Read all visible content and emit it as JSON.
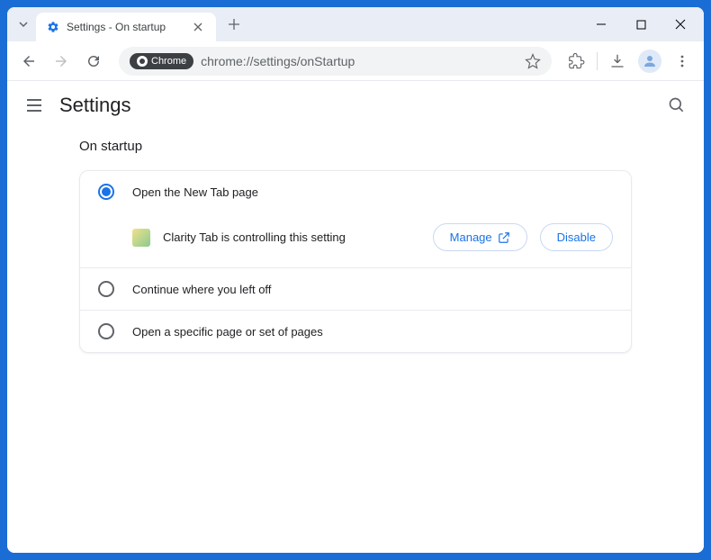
{
  "titlebar": {
    "tab_title": "Settings - On startup"
  },
  "toolbar": {
    "chrome_chip": "Chrome",
    "url": "chrome://settings/onStartup"
  },
  "header": {
    "title": "Settings"
  },
  "section": {
    "title": "On startup",
    "options": [
      {
        "label": "Open the New Tab page",
        "selected": true
      },
      {
        "label": "Continue where you left off",
        "selected": false
      },
      {
        "label": "Open a specific page or set of pages",
        "selected": false
      }
    ],
    "notice": {
      "text": "Clarity Tab is controlling this setting",
      "manage_label": "Manage",
      "disable_label": "Disable"
    }
  }
}
